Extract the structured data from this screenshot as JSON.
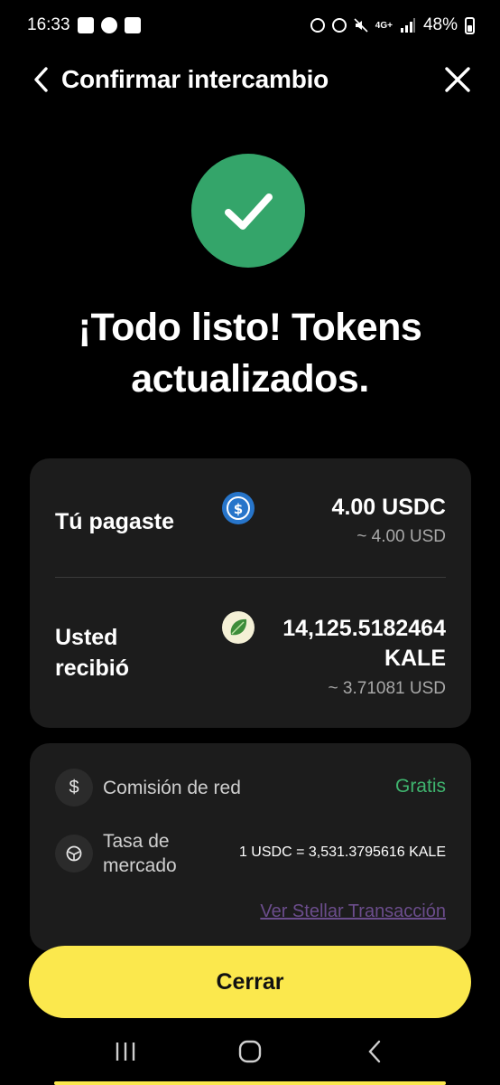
{
  "status_bar": {
    "time": "16:33",
    "network": "4G+",
    "battery": "48%"
  },
  "header": {
    "title": "Confirmar intercambio"
  },
  "headline": "¡Todo listo! Tokens actualizados.",
  "swap": {
    "paid_label": "Tú pagaste",
    "paid_amount": "4.00 USDC",
    "paid_usd": "~ 4.00 USD",
    "received_label_line1": "Usted",
    "received_label_line2": "recibió",
    "received_amount_line1": "14,125.5182464",
    "received_amount_line2": "KALE",
    "received_usd": "~ 3.71081 USD"
  },
  "details": {
    "fee_label": "Comisión de red",
    "fee_value": "Gratis",
    "rate_label_line1": "Tasa de",
    "rate_label_line2": "mercado",
    "rate_value": "1 USDC = 3,531.3795616 KALE",
    "link_text": "Ver Stellar Transacción"
  },
  "close_button": "Cerrar",
  "colors": {
    "accent": "#fbe84d",
    "success": "#34a56a",
    "free": "#3fb46e",
    "link": "#6b4d8c",
    "card": "#1c1c1c"
  },
  "icons": [
    "usdc-token-icon",
    "kale-token-icon",
    "dollar-icon",
    "market-rate-icon",
    "checkmark-icon"
  ]
}
